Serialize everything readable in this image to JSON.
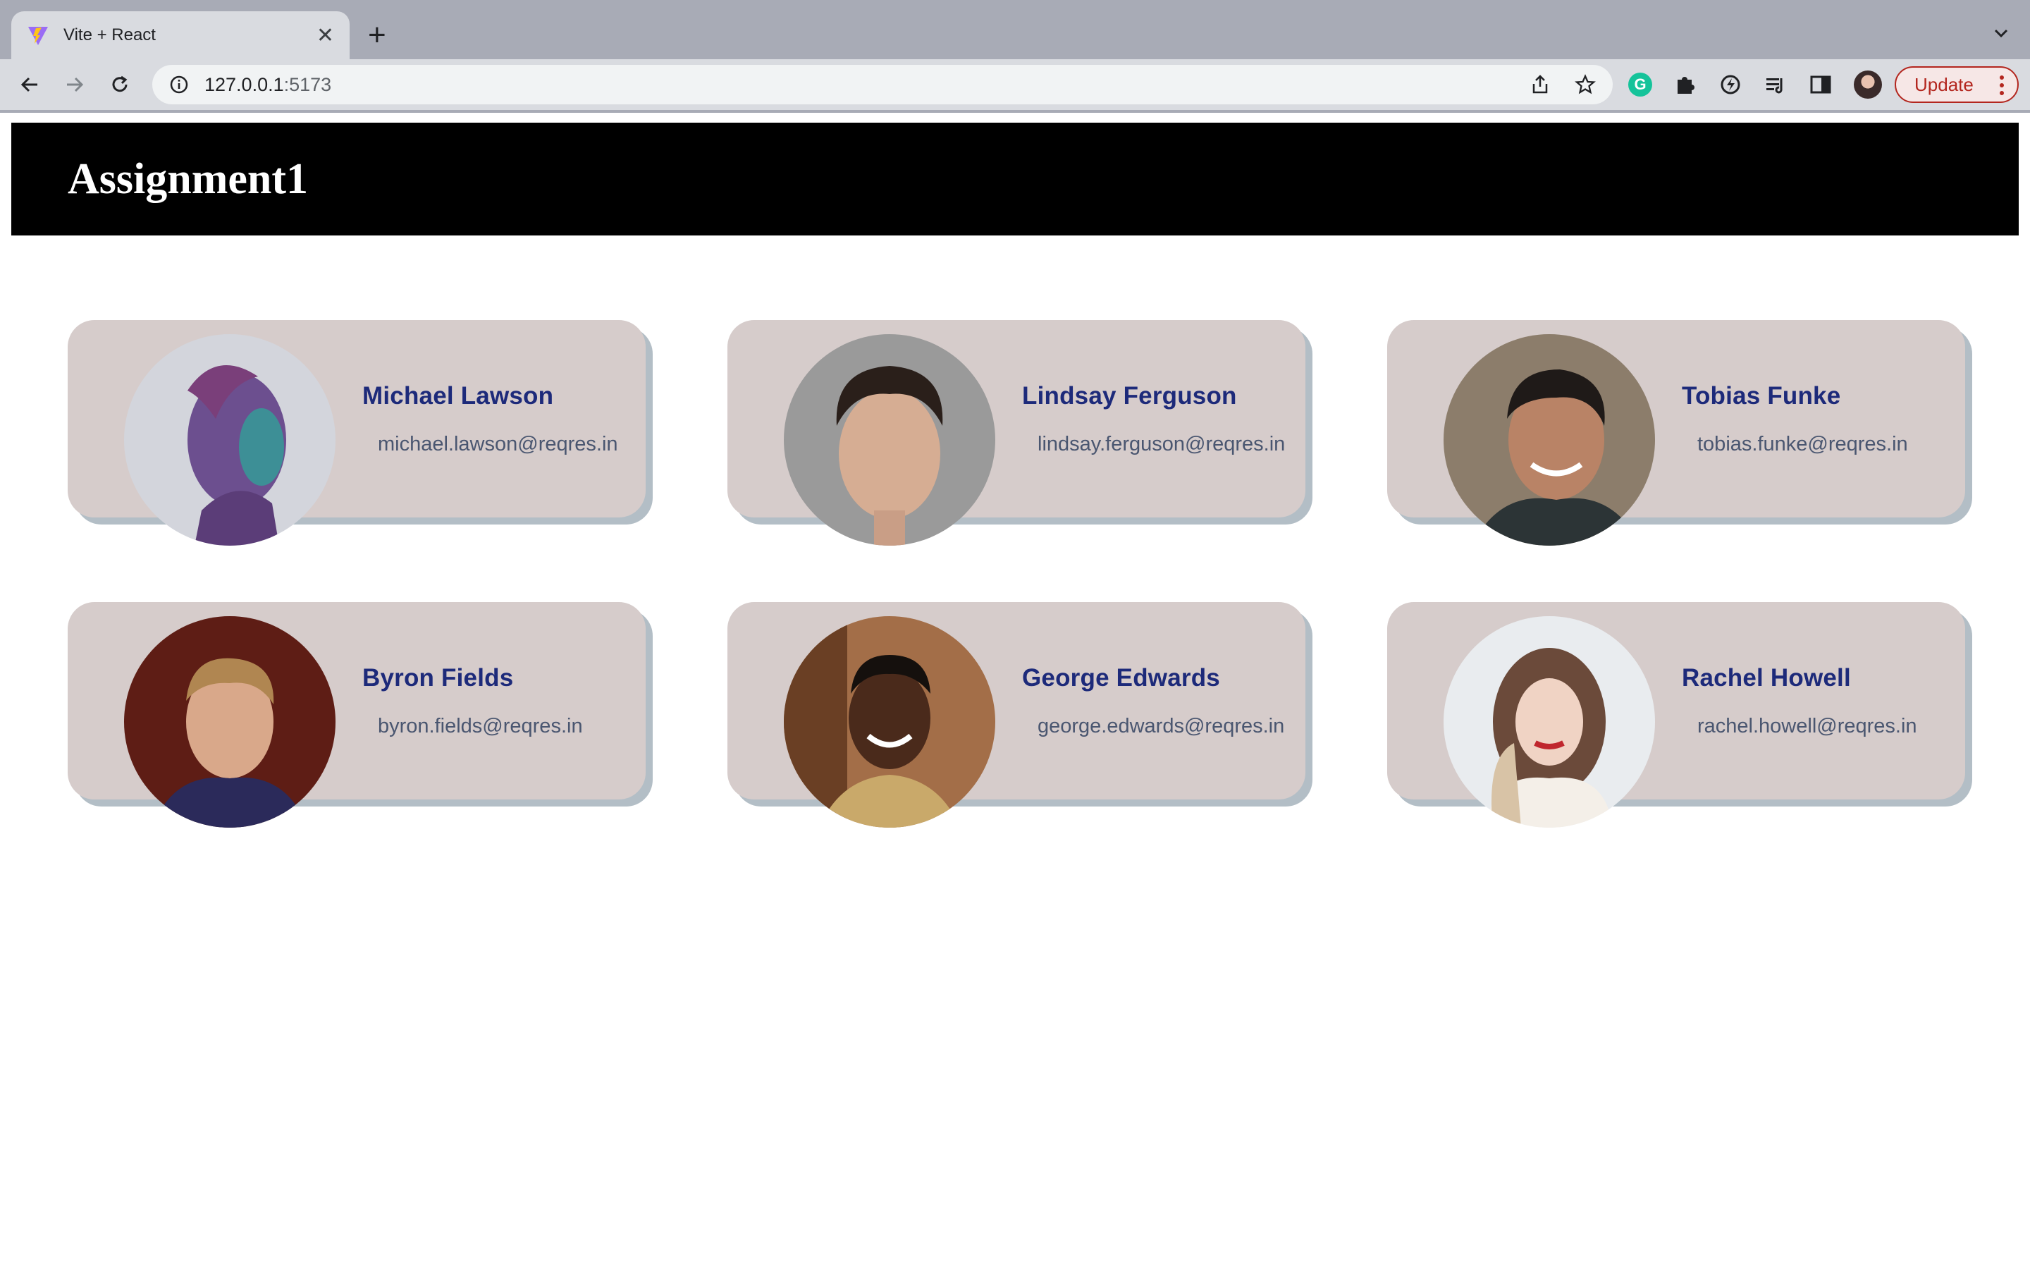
{
  "browser": {
    "tab_title": "Vite + React",
    "url_host": "127.0.0.1",
    "url_port": ":5173",
    "update_label": "Update"
  },
  "page": {
    "title": "Assignment1"
  },
  "users": [
    {
      "name": "Michael Lawson",
      "email": "michael.lawson@reqres.in",
      "avatar": "michael-lawson-photo"
    },
    {
      "name": "Lindsay Ferguson",
      "email": "lindsay.ferguson@reqres.in",
      "avatar": "lindsay-ferguson-photo"
    },
    {
      "name": "Tobias Funke",
      "email": "tobias.funke@reqres.in",
      "avatar": "tobias-funke-photo"
    },
    {
      "name": "Byron Fields",
      "email": "byron.fields@reqres.in",
      "avatar": "byron-fields-photo"
    },
    {
      "name": "George Edwards",
      "email": "george.edwards@reqres.in",
      "avatar": "george-edwards-photo"
    },
    {
      "name": "Rachel Howell",
      "email": "rachel.howell@reqres.in",
      "avatar": "rachel-howell-photo"
    }
  ],
  "colors": {
    "header_bg": "#000000",
    "card_bg": "#d6cccb",
    "card_shadow": "#b3bec6",
    "name_color": "#1d2a7a",
    "email_color": "#4a5670"
  }
}
